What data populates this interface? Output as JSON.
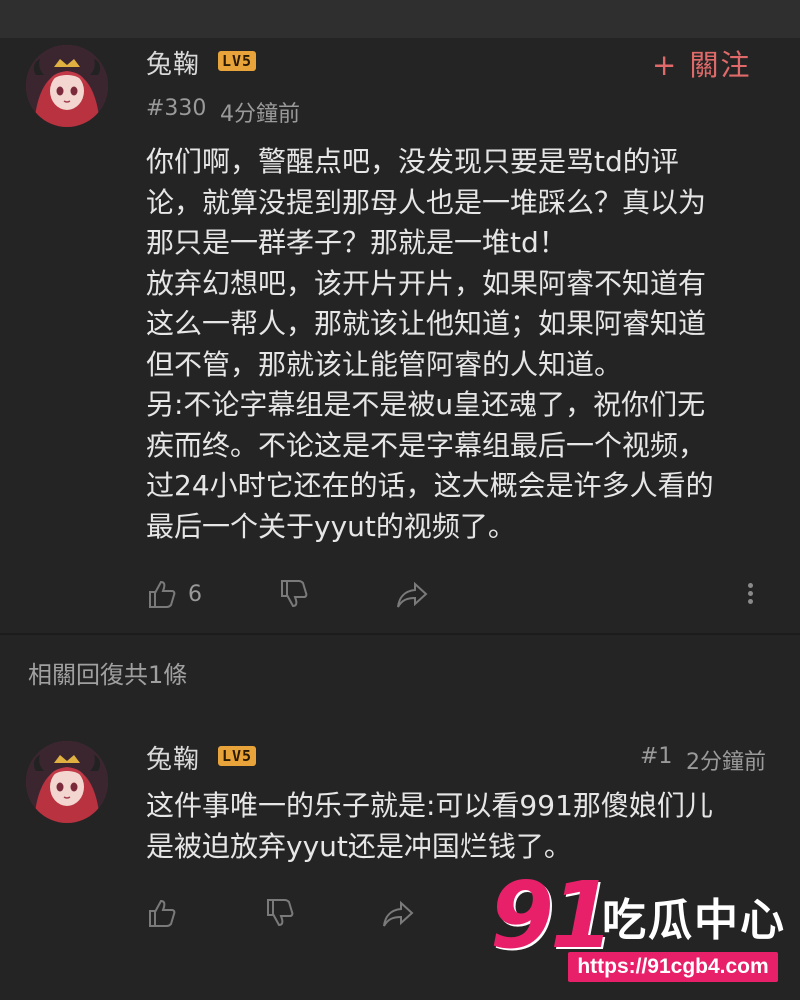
{
  "comment": {
    "username": "兔鞠",
    "level": "LV5",
    "follow_label": "+ 關注",
    "floor": "#330",
    "time": "4分鐘前",
    "text": "你们啊，警醒点吧，没发现只要是骂td的评\n论，就算没提到那母人也是一堆踩么？真以为\n那只是一群孝子？那就是一堆td！\n放弃幻想吧，该开片开片，如果阿睿不知道有\n这么一帮人，那就该让他知道；如果阿睿知道\n但不管，那就该让能管阿睿的人知道。\n另:不论字幕组是不是被u皇还魂了，祝你们无\n疾而终。不论这是不是字幕组最后一个视频，\n过24小时它还在的话，这大概会是许多人看的\n最后一个关于yyut的视频了。",
    "like_count": "6"
  },
  "related_label": "相關回復共1條",
  "reply": {
    "username": "兔鞠",
    "level": "LV5",
    "floor": "#1",
    "time": "2分鐘前",
    "text": "这件事唯一的乐子就是:可以看991那傻娘们儿\n是被迫放弃yyut还是冲国烂钱了。"
  },
  "watermark": {
    "number": "91",
    "title": "吃瓜中心",
    "url": "https://91cgb4.com"
  },
  "colors": {
    "background": "#242424",
    "follow": "#e06a6a",
    "level_badge": "#e8a33a",
    "watermark": "#e8206a"
  }
}
